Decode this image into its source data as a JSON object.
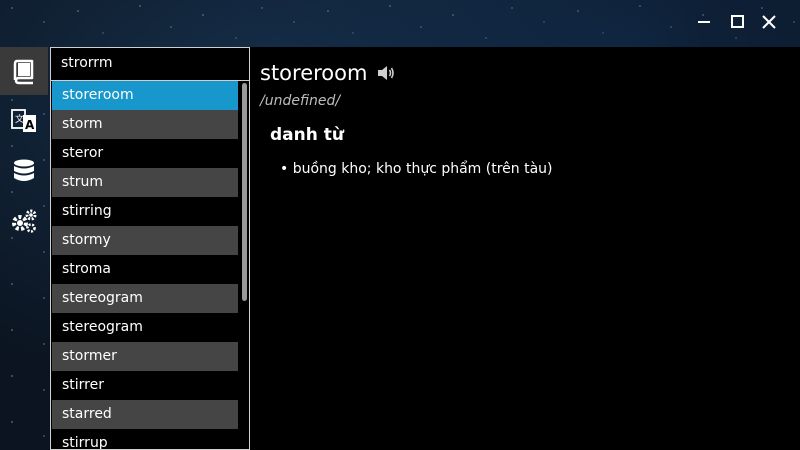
{
  "window": {
    "minimize_icon": "minimize-icon",
    "maximize_icon": "maximize-icon",
    "close_icon": "close-icon"
  },
  "sidebar": {
    "items": [
      {
        "icon": "book-icon",
        "active": true
      },
      {
        "icon": "translate-icon",
        "active": false
      },
      {
        "icon": "database-icon",
        "active": false
      },
      {
        "icon": "settings-gears-icon",
        "active": false
      }
    ]
  },
  "search": {
    "value": "strorrm"
  },
  "suggestions": [
    "storeroom",
    "storm",
    "steror",
    "strum",
    "stirring",
    "stormy",
    "stroma",
    "stereogram",
    "stereogram",
    "stormer",
    "stirrer",
    "starred",
    "stirrup"
  ],
  "selected_index": 0,
  "entry": {
    "word": "storeroom",
    "pronunciation": "/undefined/",
    "part_of_speech": "danh từ",
    "meaning": "• buồng kho; kho thực phẩm (trên tàu)"
  },
  "colors": {
    "accent": "#1797cc",
    "row_alt": "#454545",
    "background": "#000000"
  }
}
